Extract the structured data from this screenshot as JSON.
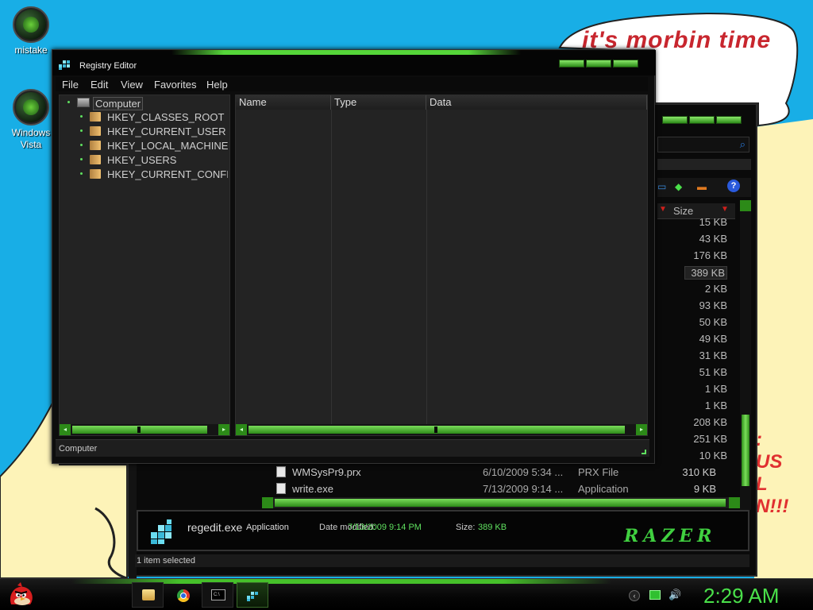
{
  "desktop": {
    "speech_text": "it's morbin time",
    "scrawl_text": ":\nUS\nL\nN!!!",
    "icons": [
      {
        "label": "mistake"
      },
      {
        "label": "Windows\nVista"
      }
    ]
  },
  "regedit": {
    "title": "Registry Editor",
    "menu": [
      "File",
      "Edit",
      "View",
      "Favorites",
      "Help"
    ],
    "tree_root": "Computer",
    "tree_items": [
      "HKEY_CLASSES_ROOT",
      "HKEY_CURRENT_USER",
      "HKEY_LOCAL_MACHINE",
      "HKEY_USERS",
      "HKEY_CURRENT_CONFI"
    ],
    "columns": [
      "Name",
      "Type",
      "Data"
    ],
    "status": "Computer"
  },
  "explorer": {
    "size_header": "Size",
    "sizes": [
      "15 KB",
      "43 KB",
      "176 KB",
      "389 KB",
      "2 KB",
      "93 KB",
      "50 KB",
      "49 KB",
      "31 KB",
      "51 KB",
      "1 KB",
      "1 KB",
      "208 KB",
      "251 KB",
      "10 KB"
    ],
    "files": [
      {
        "name": "WMSysPr9.prx",
        "date": "6/10/2009 5:34 ...",
        "type": "PRX File",
        "size": "310 KB"
      },
      {
        "name": "write.exe",
        "date": "7/13/2009 9:14 ...",
        "type": "Application",
        "size": "9 KB"
      }
    ],
    "details": {
      "name": "regedit.exe",
      "type": "Application",
      "modified_label": "Date modified:",
      "modified_value": "7/13/2009 9:14 PM",
      "size_label": "Size:",
      "size_value": "389 KB",
      "brand": "RAZER"
    },
    "status": "1 item selected"
  },
  "taskbar": {
    "clock": "2:29 AM"
  },
  "colors": {
    "accent_green": "#56d63a",
    "desktop_blue": "#18aee6",
    "text_red": "#c8262e"
  }
}
